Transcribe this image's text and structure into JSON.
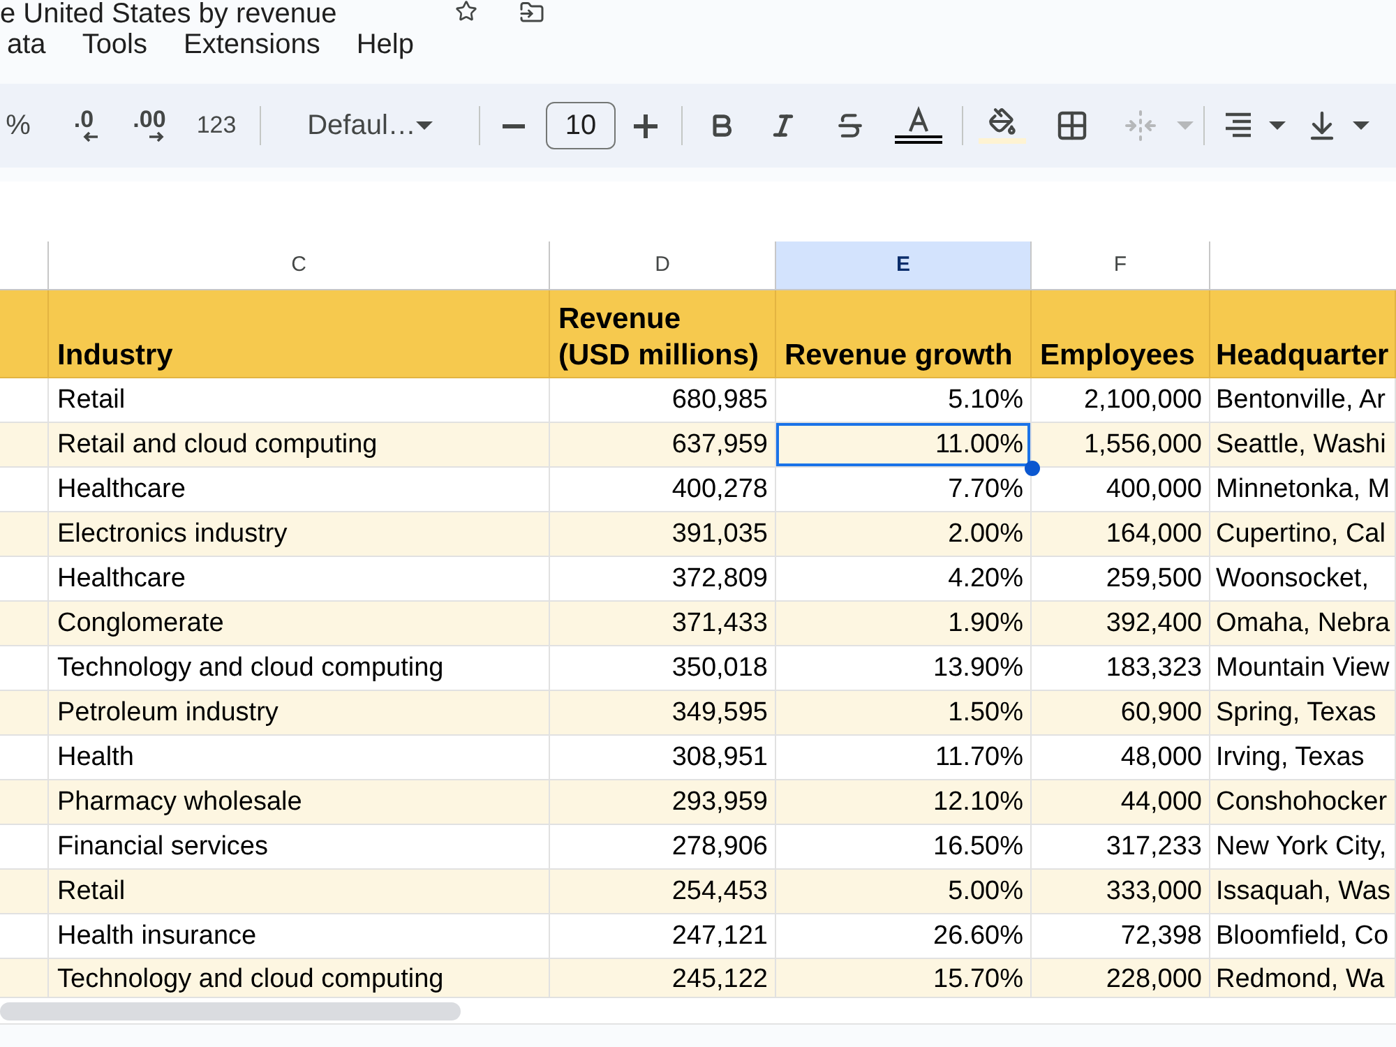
{
  "document": {
    "title": "e United States by revenue"
  },
  "menu": [
    "ata",
    "Tools",
    "Extensions",
    "Help"
  ],
  "toolbar": {
    "percent": "%",
    "decrease_decimals": ".0",
    "increase_decimals": ".00",
    "number_format": "123",
    "font": "Defaul…",
    "font_size": "10",
    "merge_disabled": true
  },
  "column_headers": [
    {
      "label": "C",
      "selected": false
    },
    {
      "label": "D",
      "selected": false
    },
    {
      "label": "E",
      "selected": true
    },
    {
      "label": "F",
      "selected": false
    }
  ],
  "table": {
    "columns": [
      "Industry",
      "Revenue\n(USD millions)",
      "Revenue growth",
      "Employees",
      "Headquarter"
    ],
    "rows": [
      {
        "cells": [
          {
            "text": "Retail",
            "selected": false
          },
          {
            "text": "680,985",
            "selected": false
          },
          {
            "text": "5.10%",
            "selected": false
          },
          {
            "text": "2,100,000",
            "selected": false
          },
          {
            "text": "Bentonville, Ar",
            "selected": false
          }
        ]
      },
      {
        "cells": [
          {
            "text": "Retail and cloud computing",
            "selected": false
          },
          {
            "text": "637,959",
            "selected": false
          },
          {
            "text": "11.00%",
            "selected": true
          },
          {
            "text": "1,556,000",
            "selected": false
          },
          {
            "text": "Seattle, Washi",
            "selected": false
          }
        ]
      },
      {
        "cells": [
          {
            "text": "Healthcare",
            "selected": false
          },
          {
            "text": "400,278",
            "selected": false
          },
          {
            "text": "7.70%",
            "selected": false
          },
          {
            "text": "400,000",
            "selected": false
          },
          {
            "text": "Minnetonka, M",
            "selected": false
          }
        ]
      },
      {
        "cells": [
          {
            "text": "Electronics industry",
            "selected": false
          },
          {
            "text": "391,035",
            "selected": false
          },
          {
            "text": "2.00%",
            "selected": false
          },
          {
            "text": "164,000",
            "selected": false
          },
          {
            "text": "Cupertino, Cal",
            "selected": false
          }
        ]
      },
      {
        "cells": [
          {
            "text": "Healthcare",
            "selected": false
          },
          {
            "text": "372,809",
            "selected": false
          },
          {
            "text": "4.20%",
            "selected": false
          },
          {
            "text": "259,500",
            "selected": false
          },
          {
            "text": "Woonsocket,",
            "selected": false
          }
        ]
      },
      {
        "cells": [
          {
            "text": "Conglomerate",
            "selected": false
          },
          {
            "text": "371,433",
            "selected": false
          },
          {
            "text": "1.90%",
            "selected": false
          },
          {
            "text": "392,400",
            "selected": false
          },
          {
            "text": "Omaha, Nebra",
            "selected": false
          }
        ]
      },
      {
        "cells": [
          {
            "text": "Technology and cloud computing",
            "selected": false
          },
          {
            "text": "350,018",
            "selected": false
          },
          {
            "text": "13.90%",
            "selected": false
          },
          {
            "text": "183,323",
            "selected": false
          },
          {
            "text": "Mountain View",
            "selected": false
          }
        ]
      },
      {
        "cells": [
          {
            "text": "Petroleum industry",
            "selected": false
          },
          {
            "text": "349,595",
            "selected": false
          },
          {
            "text": "1.50%",
            "selected": false
          },
          {
            "text": "60,900",
            "selected": false
          },
          {
            "text": "Spring, Texas",
            "selected": false
          }
        ]
      },
      {
        "cells": [
          {
            "text": "Health",
            "selected": false
          },
          {
            "text": "308,951",
            "selected": false
          },
          {
            "text": "11.70%",
            "selected": false
          },
          {
            "text": "48,000",
            "selected": false
          },
          {
            "text": "Irving, Texas",
            "selected": false
          }
        ]
      },
      {
        "cells": [
          {
            "text": "Pharmacy wholesale",
            "selected": false
          },
          {
            "text": "293,959",
            "selected": false
          },
          {
            "text": "12.10%",
            "selected": false
          },
          {
            "text": "44,000",
            "selected": false
          },
          {
            "text": "Conshohocker",
            "selected": false
          }
        ]
      },
      {
        "cells": [
          {
            "text": "Financial services",
            "selected": false
          },
          {
            "text": "278,906",
            "selected": false
          },
          {
            "text": "16.50%",
            "selected": false
          },
          {
            "text": "317,233",
            "selected": false
          },
          {
            "text": "New York City,",
            "selected": false
          }
        ]
      },
      {
        "cells": [
          {
            "text": "Retail",
            "selected": false
          },
          {
            "text": "254,453",
            "selected": false
          },
          {
            "text": "5.00%",
            "selected": false
          },
          {
            "text": "333,000",
            "selected": false
          },
          {
            "text": "Issaquah, Was",
            "selected": false
          }
        ]
      },
      {
        "cells": [
          {
            "text": "Health insurance",
            "selected": false
          },
          {
            "text": "247,121",
            "selected": false
          },
          {
            "text": "26.60%",
            "selected": false
          },
          {
            "text": "72,398",
            "selected": false
          },
          {
            "text": "Bloomfield, Co",
            "selected": false
          }
        ]
      },
      {
        "cells": [
          {
            "text": "Technology and cloud computing",
            "selected": false
          },
          {
            "text": "245,122",
            "selected": false
          },
          {
            "text": "15.70%",
            "selected": false
          },
          {
            "text": "228,000",
            "selected": false
          },
          {
            "text": "Redmond, Wa",
            "selected": false
          }
        ]
      }
    ]
  }
}
